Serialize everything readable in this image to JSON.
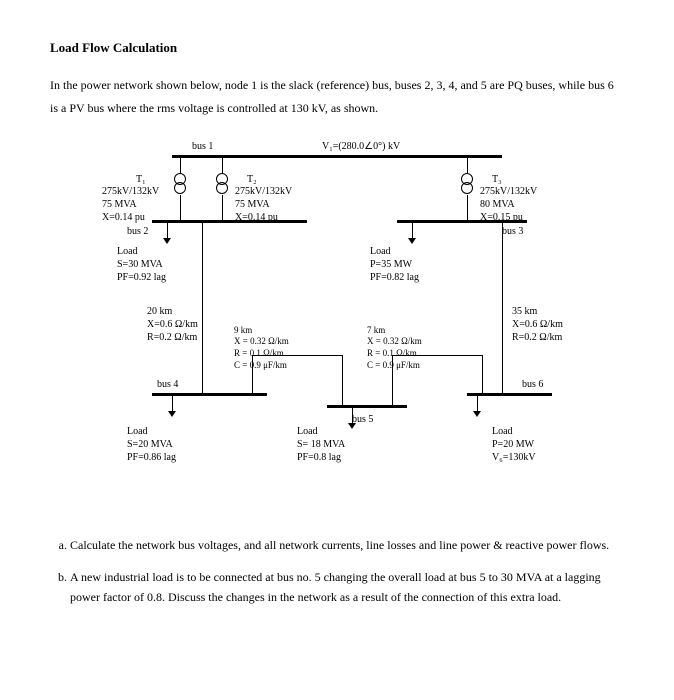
{
  "title": "Load Flow Calculation",
  "intro": "In the power network shown below, node 1 is the slack (reference) bus, buses 2, 3, 4, and 5 are PQ buses, while bus 6 is a PV bus where the rms voltage is controlled at 130 kV, as shown.",
  "diagram": {
    "bus1_label": "bus 1",
    "v1": "V₁=(280.0∠0°) kV",
    "t1_name": "T₁",
    "t1_specs": "275kV/132kV\n75 MVA\nX=0.14 pu",
    "t2_name": "T₂",
    "t2_specs": "275kV/132kV\n75 MVA\nX=0.14 pu",
    "t3_name": "T₃",
    "t3_specs": "275kV/132kV\n80 MVA\nX=0.15 pu",
    "bus2_label": "bus 2",
    "bus3_label": "bus 3",
    "load2": "Load\nS=30 MVA\nPF=0.92 lag",
    "load3": "Load\nP=35 MW\nPF=0.82 lag",
    "line24": "20 km\nX=0.6 Ω/km\nR=0.2 Ω/km",
    "line36": "35 km\nX=0.6 Ω/km\nR=0.2 Ω/km",
    "line45": "9 km\nX = 0.32 Ω/km\nR = 0.1 Ω/km\nC = 0.9 μF/km",
    "line56": "7 km\nX = 0.32 Ω/km\nR = 0.1 Ω/km\nC = 0.9 μF/km",
    "bus4_label": "bus 4",
    "bus5_label": "bus 5",
    "bus6_label": "bus 6",
    "load4": "Load\nS=20 MVA\nPF=0.86 lag",
    "load5": "Load\nS= 18 MVA\nPF=0.8 lag",
    "load6": "Load\nP=20 MW\nV₆=130kV"
  },
  "question_a": "Calculate the network bus voltages, and all network currents, line losses and line power & reactive power flows.",
  "question_b": "A new industrial load is to be connected at bus no. 5 changing the overall load at bus 5 to 30 MVA at a lagging power factor of 0.8. Discuss the changes in the network as a result of the connection of this extra load."
}
